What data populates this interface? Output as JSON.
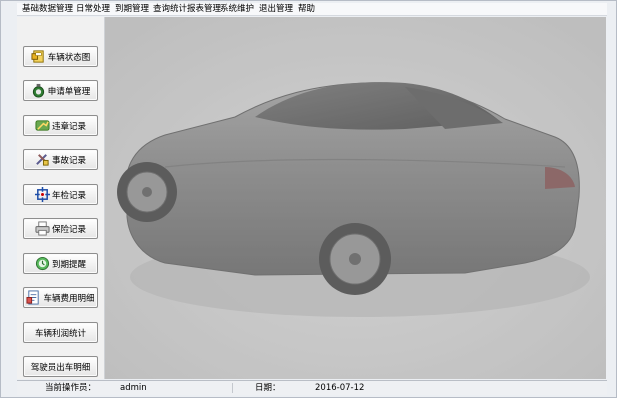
{
  "menu": [
    {
      "label": "基础数据管理"
    },
    {
      "label": "日常处理"
    },
    {
      "label": "到期管理"
    },
    {
      "label": "查询统计报表管理"
    },
    {
      "label": "系统维护"
    },
    {
      "label": "退出管理"
    },
    {
      "label": "帮助"
    }
  ],
  "sidebar": {
    "buttons": [
      {
        "label": "车辆状态图",
        "icon": "car-status-icon"
      },
      {
        "label": "申请单管理",
        "icon": "money-bag-icon"
      },
      {
        "label": "违章记录",
        "icon": "violation-icon"
      },
      {
        "label": "事故记录",
        "icon": "accident-tools-icon"
      },
      {
        "label": "年检记录",
        "icon": "inspection-icon"
      },
      {
        "label": "保险记录",
        "icon": "printer-icon"
      },
      {
        "label": "到期提醒",
        "icon": "reminder-icon"
      },
      {
        "label": "车辆费用明细",
        "icon": "cost-detail-icon"
      },
      {
        "label": "车辆利润统计",
        "icon": ""
      },
      {
        "label": "驾驶员出车明细",
        "icon": ""
      }
    ]
  },
  "status": {
    "operator_label": "当前操作员：",
    "operator_value": "admin",
    "date_label": "日期：",
    "date_value": "2016-07-12"
  },
  "colors": {
    "canvas_bg": "#c5c5c5",
    "button_border": "#8e8e8e"
  }
}
